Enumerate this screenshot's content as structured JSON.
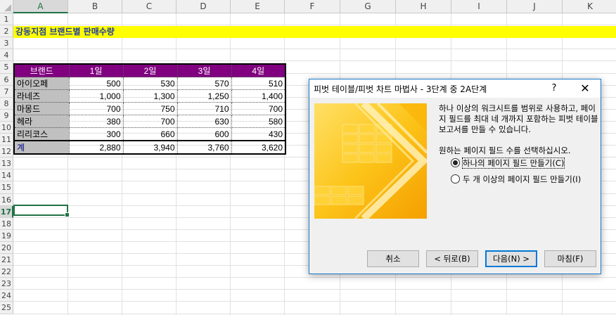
{
  "sheet": {
    "columns": [
      "A",
      "B",
      "C",
      "D",
      "E",
      "F",
      "G",
      "H",
      "I",
      "J",
      "K"
    ],
    "rows": [
      "1",
      "2",
      "3",
      "4",
      "5",
      "6",
      "7",
      "8",
      "9",
      "10",
      "11",
      "12",
      "13",
      "14",
      "15",
      "16",
      "17",
      "18",
      "19",
      "20",
      "21",
      "22",
      "23",
      "24",
      "25"
    ],
    "selected_column": "A",
    "selected_row": "17",
    "title": "강동지점 브랜드별 판매수량"
  },
  "table": {
    "headers": [
      "브랜드",
      "1일",
      "2일",
      "3일",
      "4일"
    ],
    "rows": [
      {
        "name": "아이오페",
        "values": [
          "500",
          "530",
          "570",
          "510"
        ]
      },
      {
        "name": "라네즈",
        "values": [
          "1,000",
          "1,300",
          "1,250",
          "1,400"
        ]
      },
      {
        "name": "마몽드",
        "values": [
          "700",
          "750",
          "710",
          "700"
        ]
      },
      {
        "name": "헤라",
        "values": [
          "380",
          "700",
          "630",
          "580"
        ]
      },
      {
        "name": "리리코스",
        "values": [
          "300",
          "660",
          "600",
          "430"
        ]
      }
    ],
    "total": {
      "name": "계",
      "values": [
        "2,880",
        "3,940",
        "3,760",
        "3,620"
      ]
    }
  },
  "dialog": {
    "title": "피벗 테이블/피벗 차트 마법사 - 3단계 중 2A단계",
    "help_label": "?",
    "close_label": "✕",
    "description": "하나 이상의 워크시트를 범위로 사용하고, 페이지 필드를 최대 네 개까지 포함하는 피벗 테이블 보고서를 만들 수 있습니다.",
    "prompt": "원하는 페이지 필드 수를 선택하십시오.",
    "options": [
      {
        "label": "하나의 페이지 필드 만들기(C)",
        "selected": true
      },
      {
        "label": "두 개 이상의 페이지 필드 만들기(I)",
        "selected": false
      }
    ],
    "buttons": {
      "cancel": "취소",
      "back": "< 뒤로(B)",
      "next": "다음(N) >",
      "finish": "마침(F)"
    }
  },
  "colors": {
    "title_band": "#ffff00",
    "header_fill": "#800080",
    "name_fill": "#c0c0c0",
    "excel_green": "#217346"
  }
}
